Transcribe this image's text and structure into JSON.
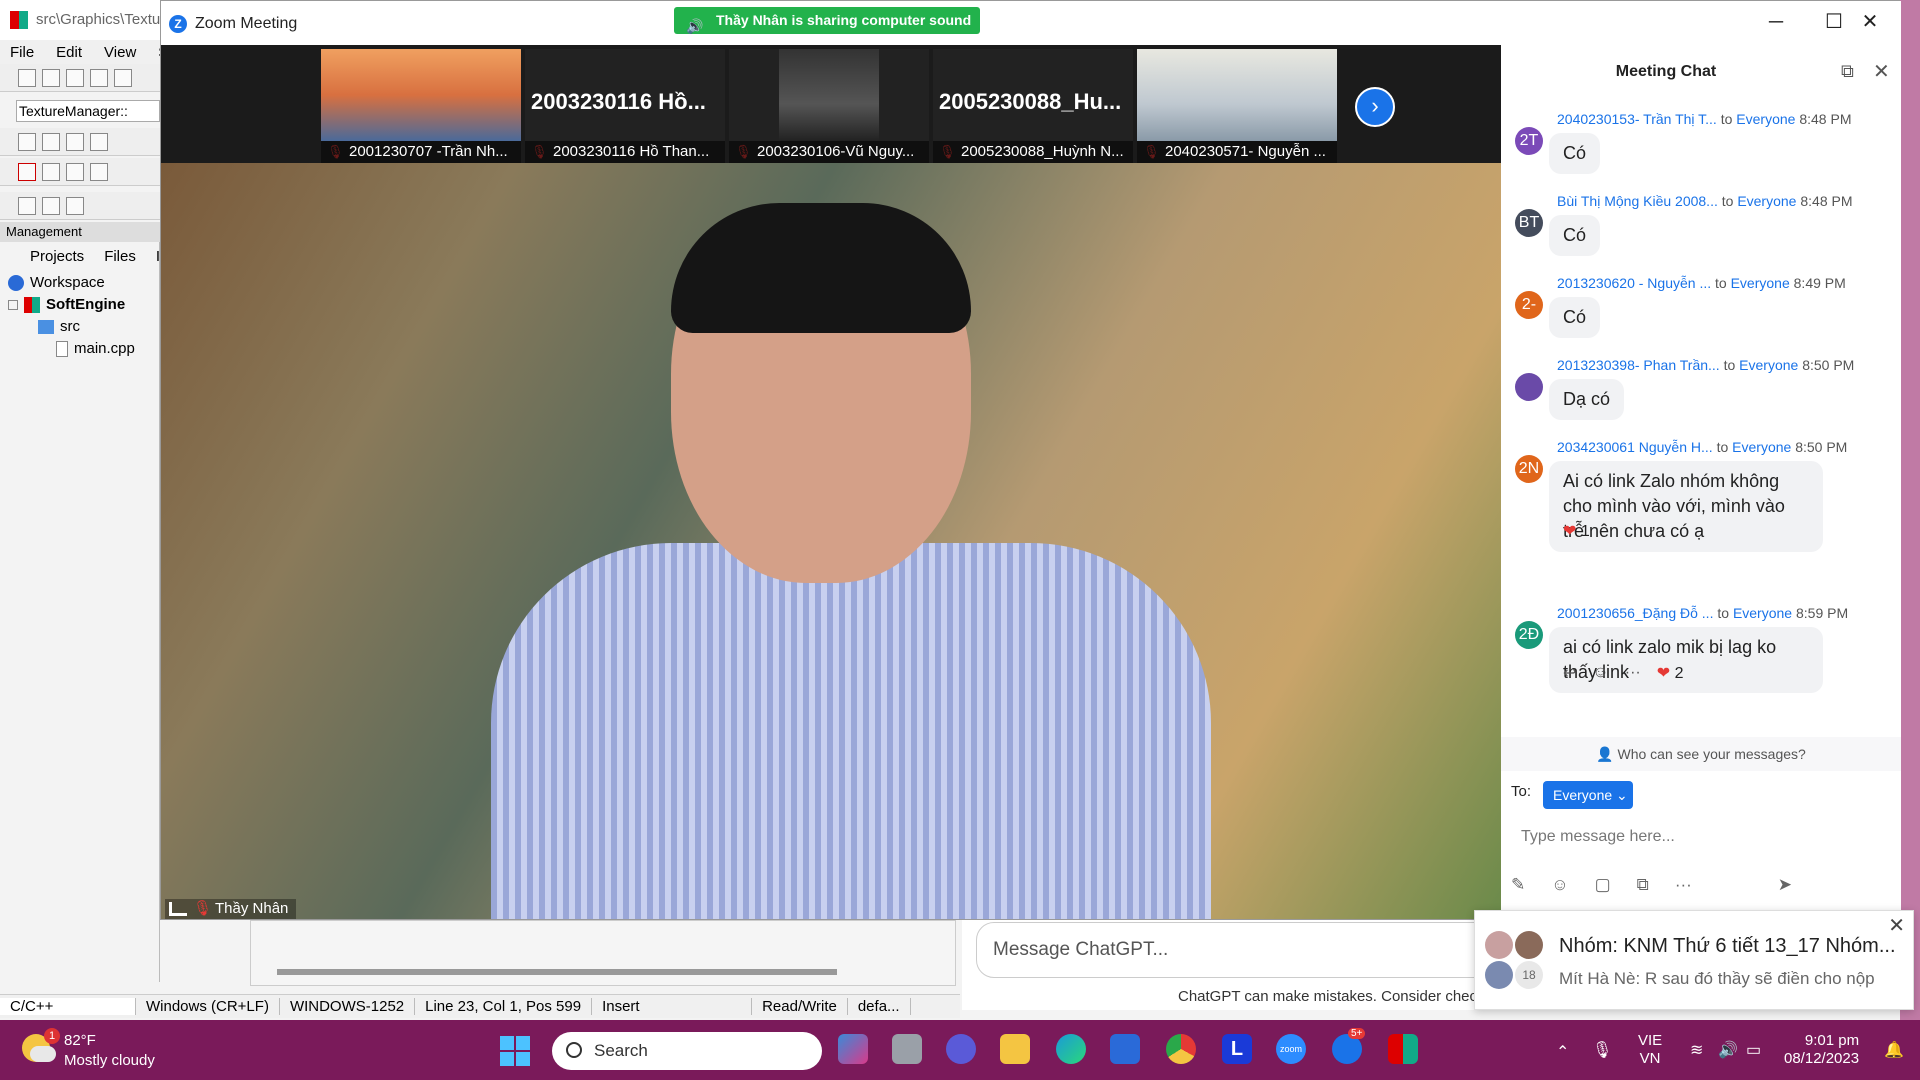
{
  "ide": {
    "title": "src\\Graphics\\Textu",
    "menu": [
      "File",
      "Edit",
      "View",
      "Se"
    ],
    "combo": "TextureManager::",
    "management": "Management",
    "tabs": [
      "Projects",
      "Files",
      "I"
    ],
    "tree": [
      {
        "label": "Workspace",
        "bold": false
      },
      {
        "label": "SoftEngine",
        "bold": true
      },
      {
        "label": "src",
        "bold": false
      },
      {
        "label": "main.cpp",
        "bold": false
      }
    ],
    "status": [
      "C/C++",
      "Windows (CR+LF)",
      "WINDOWS-1252",
      "Line 23, Col 1, Pos 599",
      "Insert",
      "Read/Write",
      "defa..."
    ]
  },
  "chatgpt": {
    "placeholder": "Message ChatGPT...",
    "disclaimer": "ChatGPT can make mistakes. Consider chec"
  },
  "zoom": {
    "title": "Zoom Meeting",
    "sharing_banner": "Thầy Nhân is sharing computer sound",
    "participants": [
      {
        "label": "2001230707 -Trần Nh...",
        "big_name": ""
      },
      {
        "label": "2003230116 Hồ Than...",
        "big_name": "2003230116 Hồ..."
      },
      {
        "label": "2003230106-Vũ Nguy...",
        "big_name": ""
      },
      {
        "label": "2005230088_Huỳnh N...",
        "big_name": "2005230088_Hu..."
      },
      {
        "label": "2040230571- Nguyễn ...",
        "big_name": ""
      }
    ],
    "speaker_name": "Thầy Nhân"
  },
  "chat": {
    "title": "Meeting Chat",
    "messages": [
      {
        "initials": "2T",
        "color": "#7b4ab8",
        "sender": "2040230153- Trần Thị T...",
        "to": "to",
        "recipient": "Everyone",
        "time": "8:48 PM",
        "text": "Có"
      },
      {
        "initials": "BT",
        "color": "#444c5c",
        "sender": "Bùi Thị Mộng Kiều 2008...",
        "to": "to",
        "recipient": "Everyone",
        "time": "8:48 PM",
        "text": "Có"
      },
      {
        "initials": "2-",
        "color": "#e0661b",
        "sender": "2013230620 - Nguyễn ...",
        "to": "to",
        "recipient": "Everyone",
        "time": "8:49 PM",
        "text": "Có"
      },
      {
        "initials": "",
        "color": "#6a4aa8",
        "sender": "2013230398- Phan Trần...",
        "to": "to",
        "recipient": "Everyone",
        "time": "8:50 PM",
        "text": "Dạ có"
      },
      {
        "initials": "2N",
        "color": "#e0661b",
        "sender": "2034230061 Nguyễn H...",
        "to": "to",
        "recipient": "Everyone",
        "time": "8:50 PM",
        "text": "Ai có link Zalo nhóm không cho mình vào với, mình vào trễ nên chưa có ạ"
      },
      {
        "initials": "2Đ",
        "color": "#1a9a7a",
        "sender": "2001230656_Đặng Đỗ ...",
        "to": "to",
        "recipient": "Everyone",
        "time": "8:59 PM",
        "text": "ai có link zalo mik bị lag ko thấy link"
      }
    ],
    "reaction1": "1",
    "reaction2": "2",
    "who_can_see": "Who can see your messages?",
    "to_label": "To:",
    "to_button": "Everyone",
    "input_placeholder": "Type message here..."
  },
  "toast": {
    "title": "Nhóm: KNM Thứ 6 tiết 13_17 Nhóm...",
    "message": "Mít Hà Nè: R sau đó thầy sẽ điền cho nộp",
    "count": "18"
  },
  "taskbar": {
    "weather_temp": "82°F",
    "weather_desc": "Mostly cloudy",
    "weather_badge": "1",
    "search": "Search",
    "lang1": "VIE",
    "lang2": "VN",
    "time": "9:01 pm",
    "date": "08/12/2023",
    "zalo_badge": "5+",
    "app_letter": "L",
    "zoom_label": "zoom"
  }
}
